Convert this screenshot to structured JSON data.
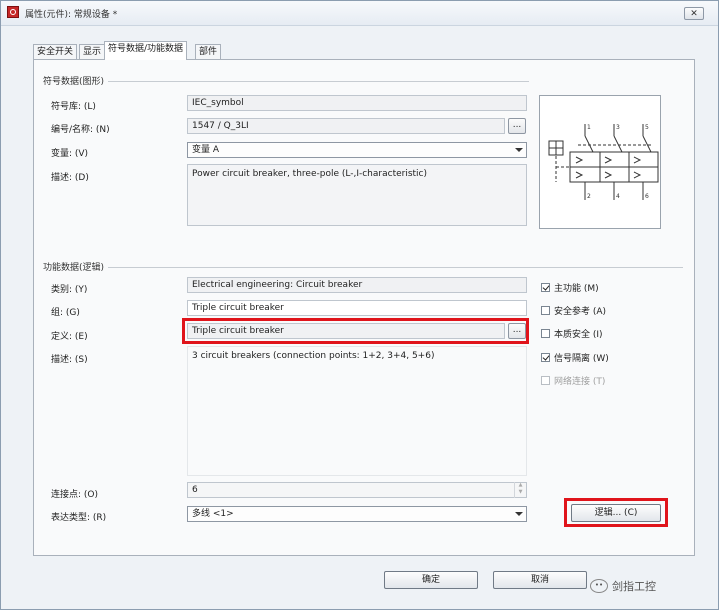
{
  "window": {
    "title": "属性(元件): 常规设备 *",
    "close": "✕"
  },
  "tabs": [
    "安全开关",
    "显示",
    "符号数据/功能数据",
    "部件"
  ],
  "symbol_group": {
    "title": "符号数据(图形)",
    "library_label": "符号库: (L)",
    "library_value": "IEC_symbol",
    "number_label": "编号/名称: (N)",
    "number_value": "1547 / Q_3LI",
    "variant_label": "变量: (V)",
    "variant_value": "变量 A",
    "desc_label": "描述: (D)",
    "desc_value": "Power circuit breaker, three-pole (L-,I-characteristic)",
    "browse": "..."
  },
  "preview": {
    "pins_top": [
      "1",
      "3",
      "5"
    ],
    "pins_bottom": [
      "2",
      "4",
      "6"
    ]
  },
  "function_group": {
    "title": "功能数据(逻辑)",
    "category_label": "类别: (Y)",
    "category_value": "Electrical engineering: Circuit breaker",
    "group_label": "组: (G)",
    "group_value": "Triple circuit breaker",
    "definition_label": "定义: (E)",
    "definition_value": "Triple circuit breaker",
    "desc_label": "描述: (S)",
    "desc_value": "3 circuit breakers (connection points: 1+2, 3+4, 5+6)",
    "connections_label": "连接点: (O)",
    "connections_value": "6",
    "repr_label": "表达类型: (R)",
    "repr_value": "多线 <1>",
    "browse": "...",
    "checkboxes": [
      {
        "label": "主功能 (M)",
        "checked": true,
        "disabled": false
      },
      {
        "label": "安全参考 (A)",
        "checked": false,
        "disabled": false
      },
      {
        "label": "本质安全 (I)",
        "checked": false,
        "disabled": false
      },
      {
        "label": "信号隔离 (W)",
        "checked": true,
        "disabled": false
      },
      {
        "label": "网络连接 (T)",
        "checked": false,
        "disabled": true
      }
    ],
    "logic_button": "逻辑... (C)"
  },
  "footer": {
    "ok": "确定",
    "cancel": "取消"
  },
  "watermark": "剑指工控",
  "colors": {
    "highlight": "#e0141b",
    "icon": "#c62828"
  }
}
